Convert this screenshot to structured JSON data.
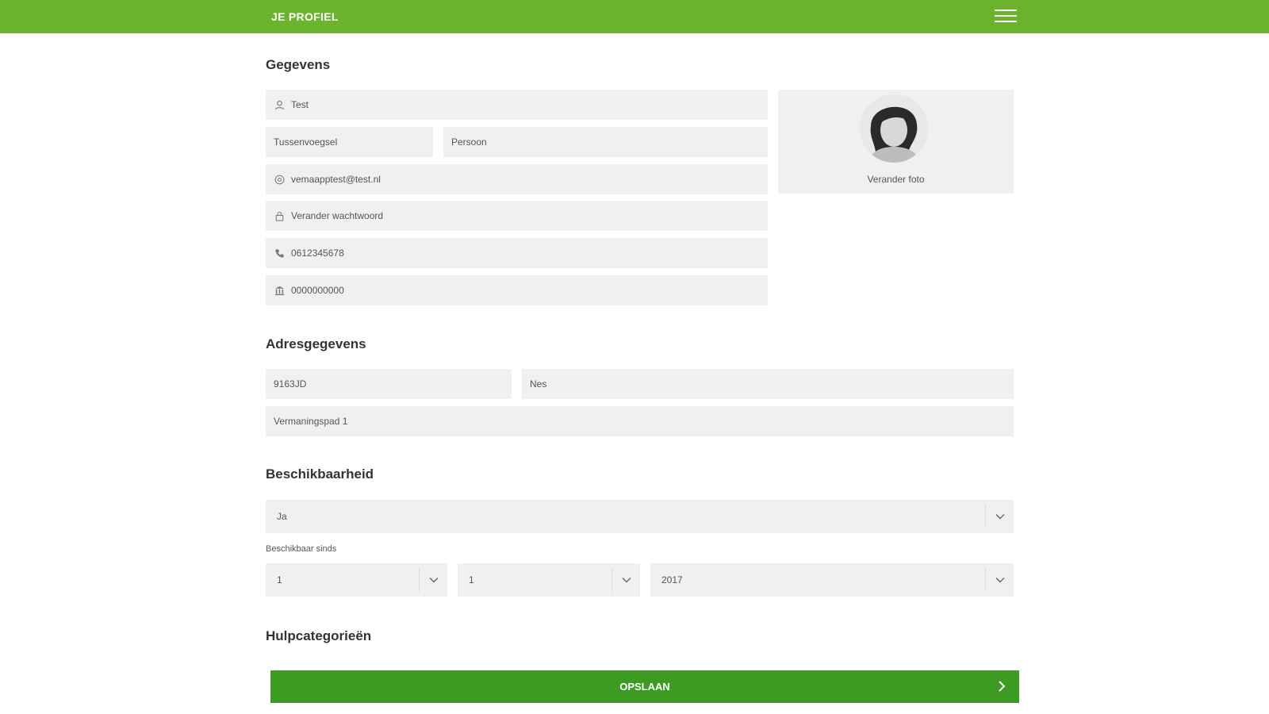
{
  "header": {
    "title": "JE PROFIEL",
    "menu_icon": "hamburger-menu-icon",
    "background": "#6db42e"
  },
  "sections": {
    "gegevens": "Gegevens",
    "adres": "Adresgegevens",
    "beschikbaarheid": "Beschikbaarheid",
    "hulpcategorieen": "Hulpcategorieën"
  },
  "gegevens": {
    "first_name": "Test",
    "tussenvoegsel": "Tussenvoegsel",
    "last_name": "Persoon",
    "email": "vemaapptest@test.nl",
    "password": "Verander wachtwoord",
    "phone": "0612345678",
    "bank": "0000000000"
  },
  "photo": {
    "label": "Verander foto"
  },
  "adres": {
    "postcode": "9163JD",
    "city": "Nes",
    "street": "Vermaningspad 1"
  },
  "beschikbaarheid": {
    "available": "Ja",
    "since_label": "Beschikbaar sinds",
    "day": "1",
    "month": "1",
    "year": "2017"
  },
  "save": {
    "label": "OPSLAAN",
    "background": "#3d9a22"
  }
}
